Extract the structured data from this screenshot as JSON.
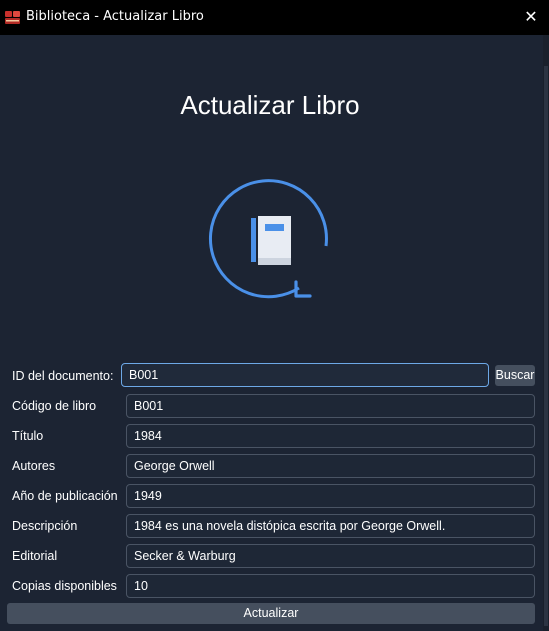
{
  "window": {
    "title": "Biblioteca - Actualizar Libro",
    "close_glyph": "✕"
  },
  "heading": "Actualizar Libro",
  "icons": {
    "app": "book-stack-icon",
    "hero": "book-update-icon",
    "close": "close-icon"
  },
  "colors": {
    "accent": "#4a90e8",
    "background": "#1b2331",
    "titlebar": "#000000",
    "button": "#454f5e"
  },
  "search": {
    "label": "ID del documento:",
    "value": "B001",
    "button": "Buscar"
  },
  "fields": [
    {
      "label": "Código de libro",
      "value": "B001"
    },
    {
      "label": "Título",
      "value": "1984"
    },
    {
      "label": "Autores",
      "value": "George Orwell"
    },
    {
      "label": "Año de publicación",
      "value": "1949"
    },
    {
      "label": "Descripción",
      "value": "1984 es una novela distópica escrita por George Orwell."
    },
    {
      "label": "Editorial",
      "value": "Secker & Warburg"
    },
    {
      "label": "Copias disponibles",
      "value": "10"
    }
  ],
  "submit": "Actualizar"
}
